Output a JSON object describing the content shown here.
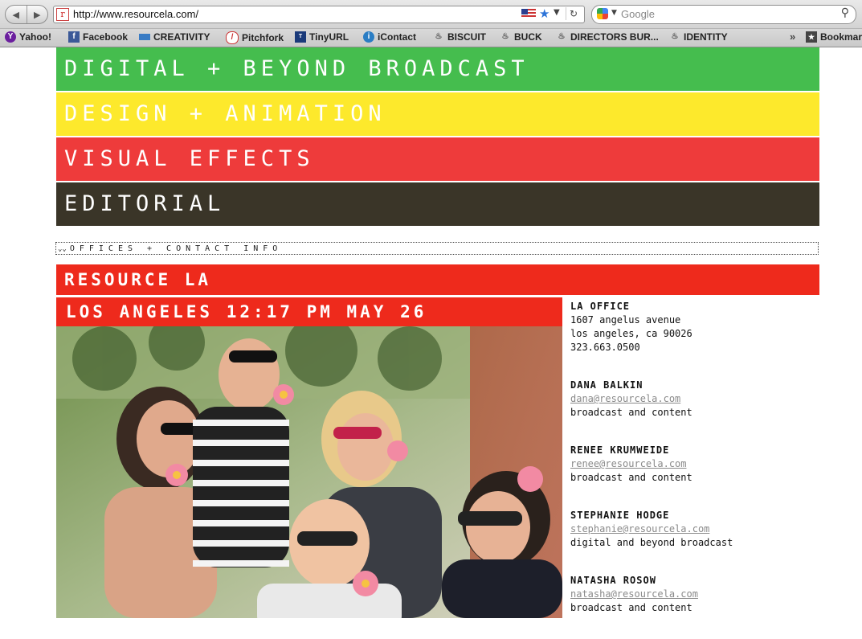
{
  "browser": {
    "url": "http://www.resourcela.com/",
    "search_placeholder": "Google",
    "bookmarks": [
      "Yahoo!",
      "Facebook",
      "CREATIVITY",
      "Pitchfork",
      "TinyURL",
      "iContact",
      "BISCUIT",
      "BUCK",
      "DIRECTORS BUR...",
      "IDENTITY"
    ],
    "bookmarks_menu": "Bookmar"
  },
  "nav": {
    "items": [
      {
        "label": "DIGITAL + BEYOND BROADCAST",
        "color": "#45bd4e"
      },
      {
        "label": "DESIGN + ANIMATION",
        "color": "#fde92c"
      },
      {
        "label": "VISUAL EFFECTS",
        "color": "#ee3b3b"
      },
      {
        "label": "EDITORIAL",
        "color": "#3a3528"
      }
    ]
  },
  "offices_toggle": "OFFICES + CONTACT INFO",
  "office_title": "RESOURCE LA",
  "clock": "LOS ANGELES 12:17 PM MAY 26",
  "office": {
    "heading": "LA OFFICE",
    "street": "1607 angelus avenue",
    "city": "los angeles, ca 90026",
    "phone": "323.663.0500"
  },
  "contacts": [
    {
      "name": "DANA BALKIN",
      "email": "dana@resourcela.com",
      "role": "broadcast and content"
    },
    {
      "name": "RENEE KRUMWEIDE",
      "email": "renee@resourcela.com",
      "role": "broadcast and content"
    },
    {
      "name": "STEPHANIE HODGE",
      "email": "stephanie@resourcela.com",
      "role": "digital and beyond broadcast"
    },
    {
      "name": "NATASHA ROSOW",
      "email": "natasha@resourcela.com",
      "role": "broadcast and content"
    }
  ],
  "colors": {
    "accent_red": "#ee2a1c",
    "link_gray": "#8a8a8a"
  }
}
